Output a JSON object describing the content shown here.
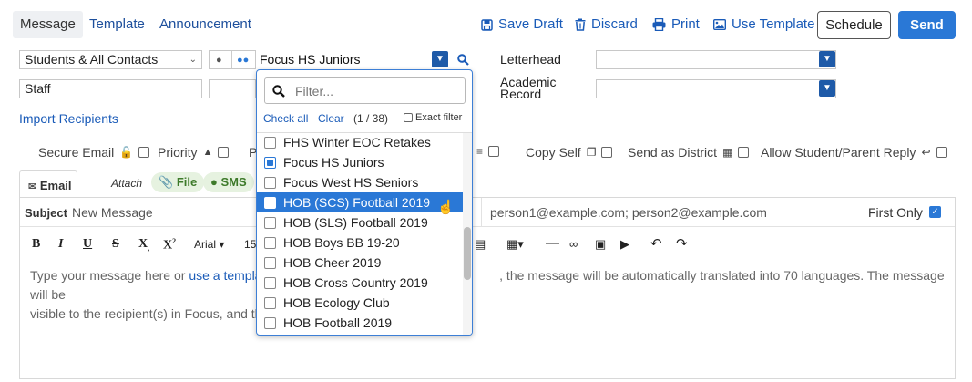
{
  "tabs": [
    {
      "label": "Message",
      "active": true
    },
    {
      "label": "Template",
      "active": false
    },
    {
      "label": "Announcement",
      "active": false
    }
  ],
  "toolbar": {
    "save_draft": "Save Draft",
    "discard": "Discard",
    "print": "Print",
    "use_template": "Use Template",
    "schedule": "Schedule",
    "send": "Send"
  },
  "recipients": {
    "audience_select": "Students & All Contacts",
    "group_value": "Focus HS Juniors",
    "staff_value": "Staff",
    "import_link": "Import Recipients"
  },
  "letterhead": {
    "label": "Letterhead",
    "academic_record_label": "Academic Record"
  },
  "options": {
    "secure_email": "Secure Email",
    "priority": "Priority",
    "p_label": "P",
    "copy_self": "Copy Self",
    "send_as_district": "Send as District",
    "allow_reply": "Allow Student/Parent Reply"
  },
  "compose": {
    "email_tab": "Email",
    "attach_label": "Attach",
    "file_chip": "File",
    "sms_chip": "SMS",
    "subject_label": "Subject",
    "subject_value": "New Message",
    "to_value": "person1@example.com; person2@example.com",
    "first_only_label": "First Only",
    "font_name": "Arial",
    "font_size": "15",
    "body_prefix": "Type your message here or ",
    "body_link": "use a template",
    "body_rest_line1": ", the message will be automatically translated into 70 languages. The message will be",
    "body_line2": "visible to the recipient(s) in Focus, and the"
  },
  "dropdown": {
    "filter_placeholder": "Filter...",
    "check_all": "Check all",
    "clear": "Clear",
    "count": "(1 / 38)",
    "exact_filter": "Exact filter",
    "items": [
      {
        "label": "FHS Winter EOC Retakes",
        "checked": false,
        "highlighted": false
      },
      {
        "label": "Focus HS Juniors",
        "checked": true,
        "highlighted": false
      },
      {
        "label": "Focus West HS Seniors",
        "checked": false,
        "highlighted": false
      },
      {
        "label": "HOB (SCS) Football 2019",
        "checked": false,
        "highlighted": true
      },
      {
        "label": "HOB (SLS) Football 2019",
        "checked": false,
        "highlighted": false
      },
      {
        "label": "HOB Boys BB 19-20",
        "checked": false,
        "highlighted": false
      },
      {
        "label": "HOB Cheer 2019",
        "checked": false,
        "highlighted": false
      },
      {
        "label": "HOB Cross Country 2019",
        "checked": false,
        "highlighted": false
      },
      {
        "label": "HOB Ecology Club",
        "checked": false,
        "highlighted": false
      },
      {
        "label": "HOB Football 2019",
        "checked": false,
        "highlighted": false
      }
    ]
  },
  "colors": {
    "accent": "#2a78d6",
    "send_bg": "#2a78d6",
    "link": "#1a5bb8"
  }
}
